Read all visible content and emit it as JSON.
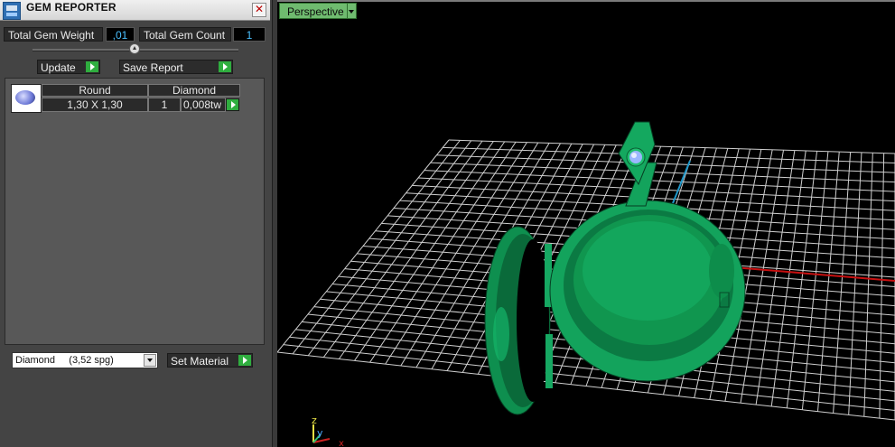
{
  "panel": {
    "title": "GEM REPORTER",
    "close_glyph": "✕",
    "total_gem_weight_label": "Total Gem Weight",
    "total_gem_weight_value": ",01",
    "total_gem_count_label": "Total Gem Count",
    "total_gem_count_value": "1",
    "update_label": "Update",
    "save_report_label": "Save Report",
    "table": {
      "headers": [
        "Round",
        "Diamond"
      ],
      "rows": [
        {
          "size": "1,30 X 1,30",
          "count": "1",
          "weight": "0,008tw"
        }
      ]
    },
    "material_select_value": "Diamond     (3,52 spg)",
    "set_material_label": "Set Material"
  },
  "viewport": {
    "tab_label": "Perspective",
    "axis_labels": {
      "z": "z",
      "y": "y",
      "x": "x"
    }
  },
  "icons": {
    "app_icon": "gem-reporter-app-icon",
    "gem_thumbnail": "round-diamond-thumbnail-icon"
  },
  "colors": {
    "accent_green": "#2fae3f",
    "value_blue": "#4ac0ff",
    "model_green": "#13a35c",
    "grid": "#d0d0d0",
    "axis_red": "#c81010",
    "axis_cyan": "#1e96c8"
  }
}
